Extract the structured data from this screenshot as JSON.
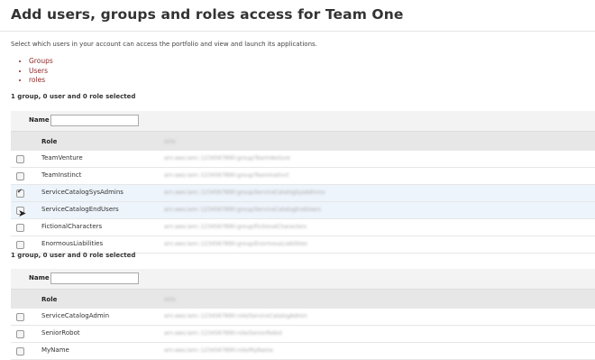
{
  "page": {
    "title": "Add users, groups and roles access for Team One",
    "description": "Select which users in your account can access the portfolio and view and launch its applications."
  },
  "links": [
    "Groups",
    "Users",
    "roles"
  ],
  "summary": "1 group, 0 user and 0 role selected",
  "table": {
    "name_label": "Name",
    "role_header": "Role",
    "arn_header": "ARN"
  },
  "table1": {
    "rows": [
      {
        "name": "TeamVenture",
        "checked": false
      },
      {
        "name": "TeamInstinct",
        "checked": false
      },
      {
        "name": "ServiceCatalogSysAdmins",
        "checked": true
      },
      {
        "name": "ServiceCatalogEndUsers",
        "checked": false
      },
      {
        "name": "FictionalCharacters",
        "checked": false
      },
      {
        "name": "EnormousLiabilities",
        "checked": false
      }
    ]
  },
  "table2": {
    "rows": [
      {
        "name": "ServiceCatalogAdmin",
        "checked": false
      },
      {
        "name": "SeniorRobot",
        "checked": false
      },
      {
        "name": "MyName",
        "checked": false
      }
    ]
  },
  "colors": {
    "link": "#8b2a2a",
    "selected_row": "#eef4fb"
  }
}
